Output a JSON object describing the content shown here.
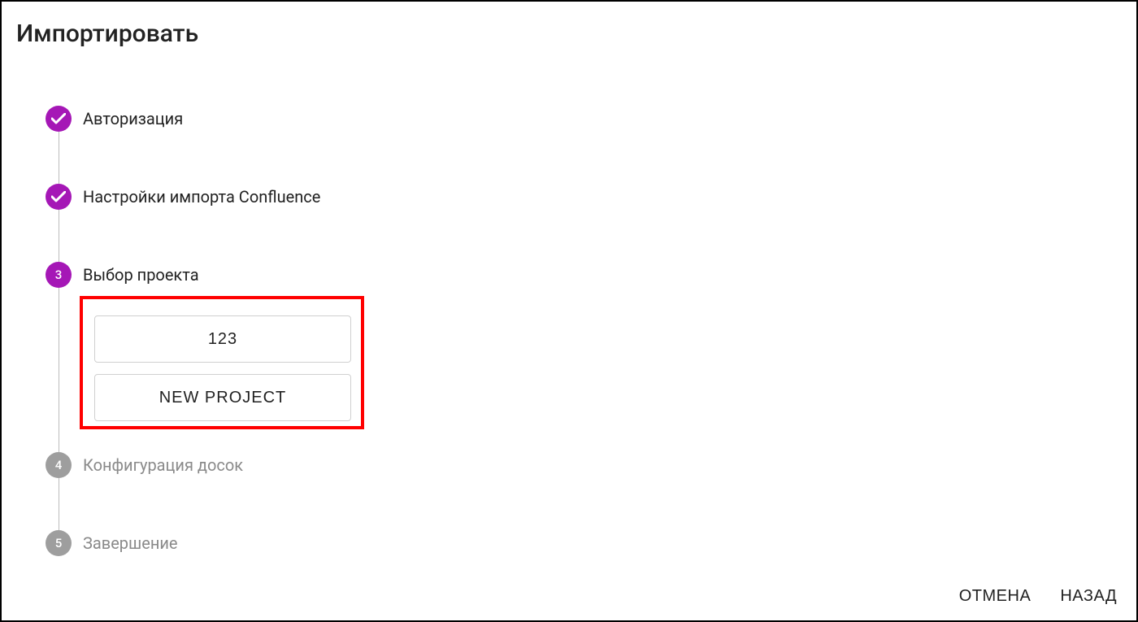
{
  "title": "Импортировать",
  "steps": {
    "s1": {
      "label": "Авторизация",
      "badge": "✓"
    },
    "s2": {
      "label": "Настройки импорта Confluence",
      "badge": "✓"
    },
    "s3": {
      "label": "Выбор проекта",
      "badge": "3"
    },
    "s4": {
      "label": "Конфигурация досок",
      "badge": "4"
    },
    "s5": {
      "label": "Завершение",
      "badge": "5"
    }
  },
  "projects": {
    "p1": "123",
    "p2": "NEW PROJECT"
  },
  "footer": {
    "cancel": "ОТМЕНА",
    "back": "НАЗАД"
  }
}
